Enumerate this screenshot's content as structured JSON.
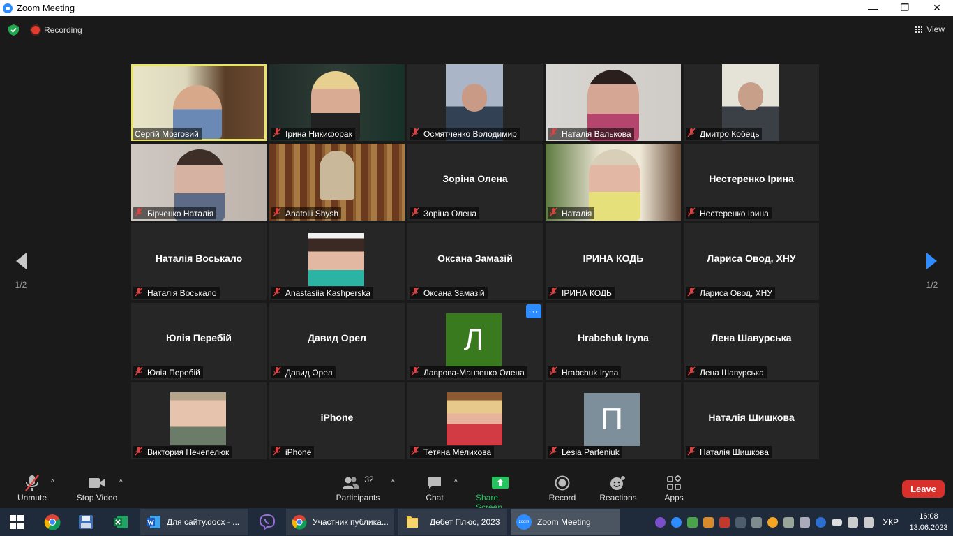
{
  "window": {
    "title": "Zoom Meeting"
  },
  "topbar": {
    "recording_label": "Recording",
    "view_label": "View"
  },
  "navigation": {
    "prev_page": "1/2",
    "next_page": "1/2"
  },
  "participants": [
    {
      "label": "Сергій Мозговий",
      "muted": false,
      "active": true
    },
    {
      "label": "Ірина Никифорак",
      "muted": true
    },
    {
      "label": "Осмятченко Володимир",
      "muted": true
    },
    {
      "label": "Наталія Валькова",
      "muted": true
    },
    {
      "label": "Дмитро Кобець",
      "muted": true
    },
    {
      "label": "Бірченко Наталія",
      "muted": true
    },
    {
      "label": "Anatolii Shysh",
      "muted": true
    },
    {
      "label": "Зоріна Олена",
      "display_name": "Зоріна Олена",
      "muted": true
    },
    {
      "label": "Наталія",
      "muted": true
    },
    {
      "label": "Нестеренко Ірина",
      "display_name": "Нестеренко Ірина",
      "muted": true
    },
    {
      "label": "Наталія Воськало",
      "display_name": "Наталія Воськало",
      "muted": true
    },
    {
      "label": "Anastasiia Kashperska",
      "muted": true
    },
    {
      "label": "Оксана Замазій",
      "display_name": "Оксана Замазій",
      "muted": true
    },
    {
      "label": "ІРИНА КОДЬ",
      "display_name": "ІРИНА КОДЬ",
      "muted": true
    },
    {
      "label": "Лариса Овод, ХНУ",
      "display_name": "Лариса Овод, ХНУ",
      "muted": true
    },
    {
      "label": "Юлія Перебій",
      "display_name": "Юлія Перебій",
      "muted": true
    },
    {
      "label": "Давид Орел",
      "display_name": "Давид Орел",
      "muted": true
    },
    {
      "label": "Лаврова-Манзенко Олена",
      "avatar_letter": "Л",
      "avatar_color": "#3a7a1f",
      "muted": true,
      "more_button": "···"
    },
    {
      "label": "Hrabchuk Iryna",
      "display_name": "Hrabchuk Iryna",
      "muted": true
    },
    {
      "label": "Лена Шавурська",
      "display_name": "Лена Шавурська",
      "muted": true
    },
    {
      "label": "Виктория Нечепелюк",
      "muted": true
    },
    {
      "label": "iPhone",
      "display_name": "iPhone",
      "muted": true
    },
    {
      "label": "Тетяна Мелихова",
      "muted": true
    },
    {
      "label": "Lesia Parfeniuk",
      "avatar_letter": "П",
      "avatar_color": "#7d8f9b",
      "muted": true
    },
    {
      "label": "Наталія Шишкова",
      "display_name": "Наталія Шишкова",
      "muted": true
    }
  ],
  "toolbar": {
    "unmute": "Unmute",
    "stop_video": "Stop Video",
    "participants": "Participants",
    "participants_count": "32",
    "chat": "Chat",
    "share_screen": "Share Screen",
    "record": "Record",
    "reactions": "Reactions",
    "apps": "Apps",
    "leave": "Leave"
  },
  "taskbar": {
    "word_doc": "Для сайту.docx - ...",
    "chrome_page": "Участник публика...",
    "folder": "Дебет Плюс, 2023",
    "zoom": "Zoom Meeting",
    "language": "УКР",
    "time": "16:08",
    "date": "13.06.2023"
  },
  "colors": {
    "accent": "#2d8cff",
    "active_speaker": "#e9e36b",
    "leave": "#d9302c",
    "share": "#22c55e"
  }
}
